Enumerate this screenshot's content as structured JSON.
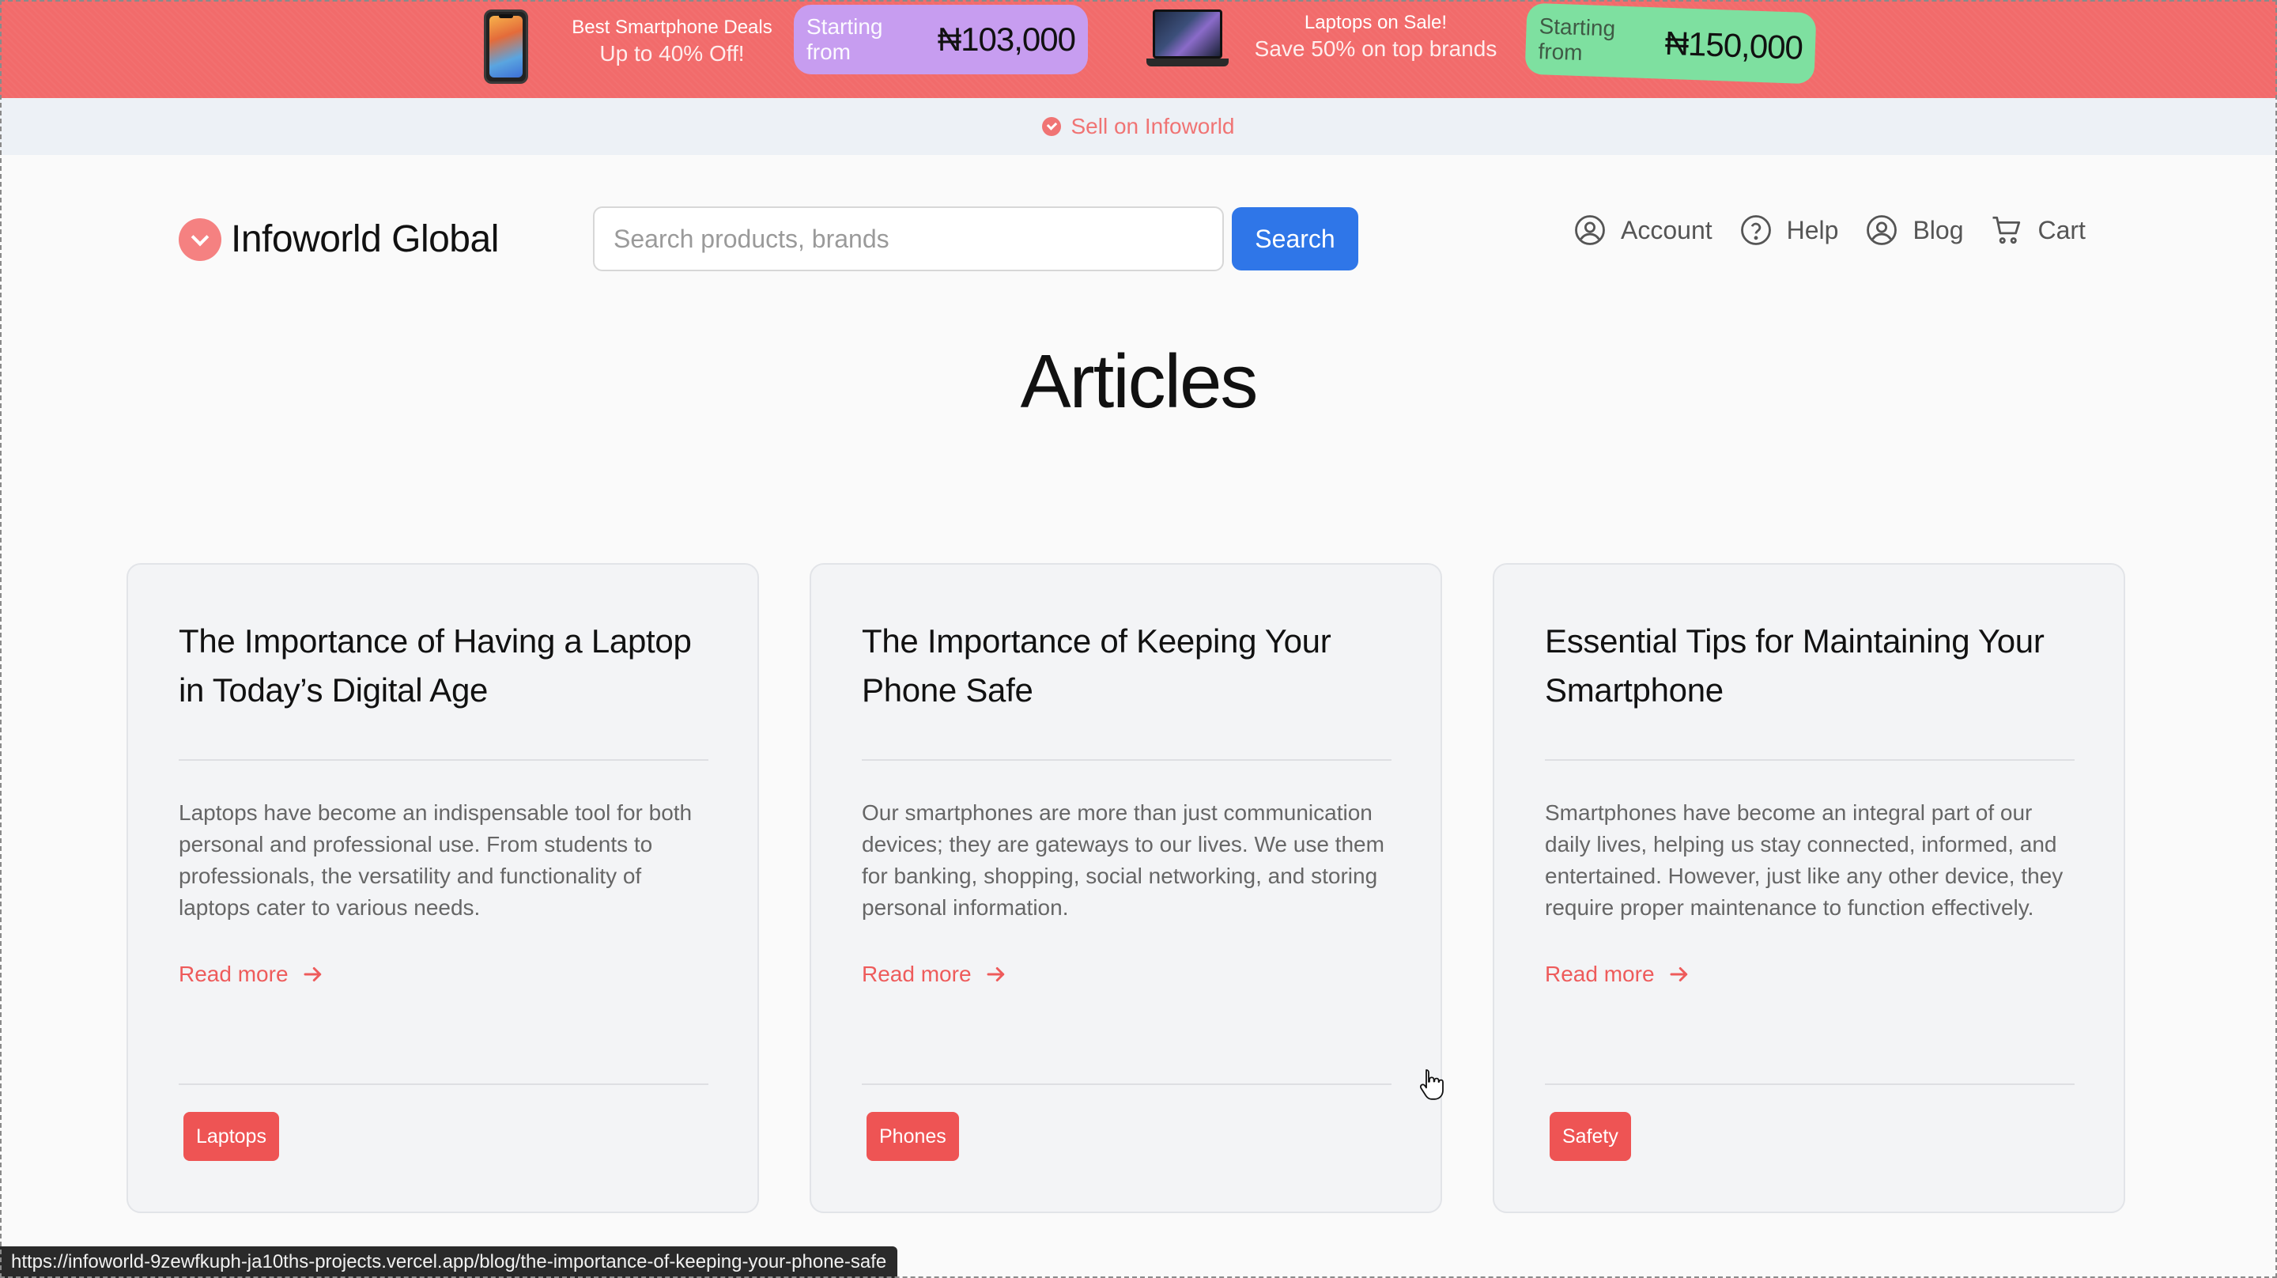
{
  "promo": {
    "deal1": {
      "title": "Best Smartphone Deals",
      "subtitle": "Up to 40% Off!",
      "price_label": "Starting from",
      "price": "₦103,000"
    },
    "deal2": {
      "title": "Laptops on Sale!",
      "subtitle": "Save 50% on top brands",
      "price_label": "Starting from",
      "price": "₦150,000"
    }
  },
  "sellbar": {
    "label": "Sell on Infoworld"
  },
  "header": {
    "logo_name": "Infoworld Global",
    "search_placeholder": "Search products, brands",
    "search_button": "Search",
    "nav": [
      {
        "label": "Account",
        "icon": "user-circle-icon"
      },
      {
        "label": "Help",
        "icon": "help-circle-icon"
      },
      {
        "label": "Blog",
        "icon": "user-circle-icon"
      },
      {
        "label": "Cart",
        "icon": "cart-icon"
      }
    ]
  },
  "page": {
    "title": "Articles"
  },
  "articles": [
    {
      "title": "The Importance of Having a Laptop in Today’s Digital Age",
      "excerpt": "Laptops have become an indispensable tool for both personal and professional use. From students to professionals, the versatility and functionality of laptops cater to various needs.",
      "read_more": "Read more",
      "tag": "Laptops"
    },
    {
      "title": "The Importance of Keeping Your Phone Safe",
      "excerpt": "Our smartphones are more than just communication devices; they are gateways to our lives. We use them for banking, shopping, social networking, and storing personal information.",
      "read_more": "Read more",
      "tag": "Phones"
    },
    {
      "title": "Essential Tips for Maintaining Your Smartphone",
      "excerpt": "Smartphones have become an integral part of our daily lives, helping us stay connected, informed, and entertained. However, just like any other device, they require proper maintenance to function effectively.",
      "read_more": "Read more",
      "tag": "Safety"
    }
  ],
  "status_bar": {
    "url": "https://infoworld-9zewfkuph-ja10ths-projects.vercel.app/blog/the-importance-of-keeping-your-phone-safe"
  },
  "colors": {
    "promo_bg": "#f26b6b",
    "accent_red": "#ee5b5b",
    "search_blue": "#2f76e8",
    "pill_purple": "#c79df0",
    "pill_green": "#7ee0a0"
  }
}
